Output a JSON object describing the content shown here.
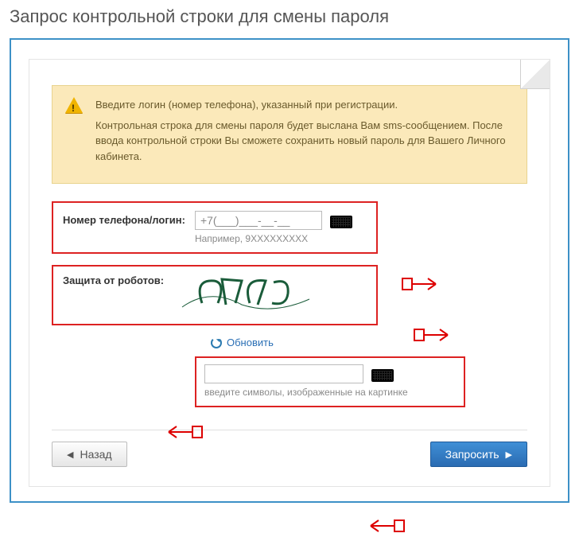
{
  "page": {
    "title": "Запрос контрольной строки для смены пароля"
  },
  "notice": {
    "line1": "Введите логин (номер телефона), указанный при регистрации.",
    "line2": "Контрольная строка для смены пароля будет выслана Вам sms-сообщением. После ввода контрольной строки Вы сможете сохранить новый пароль для Вашего Личного кабинета."
  },
  "fields": {
    "phone": {
      "label": "Номер телефона/логин:",
      "value": "+7(___)___-__-__",
      "hint": "Например, 9XXXXXXXXX"
    },
    "robot": {
      "label": "Защита от роботов:"
    },
    "captcha_refresh": "Обновить",
    "captcha_input": {
      "value": "",
      "hint": "введите символы, изображенные на картинке"
    }
  },
  "buttons": {
    "back": "Назад",
    "submit": "Запросить"
  }
}
